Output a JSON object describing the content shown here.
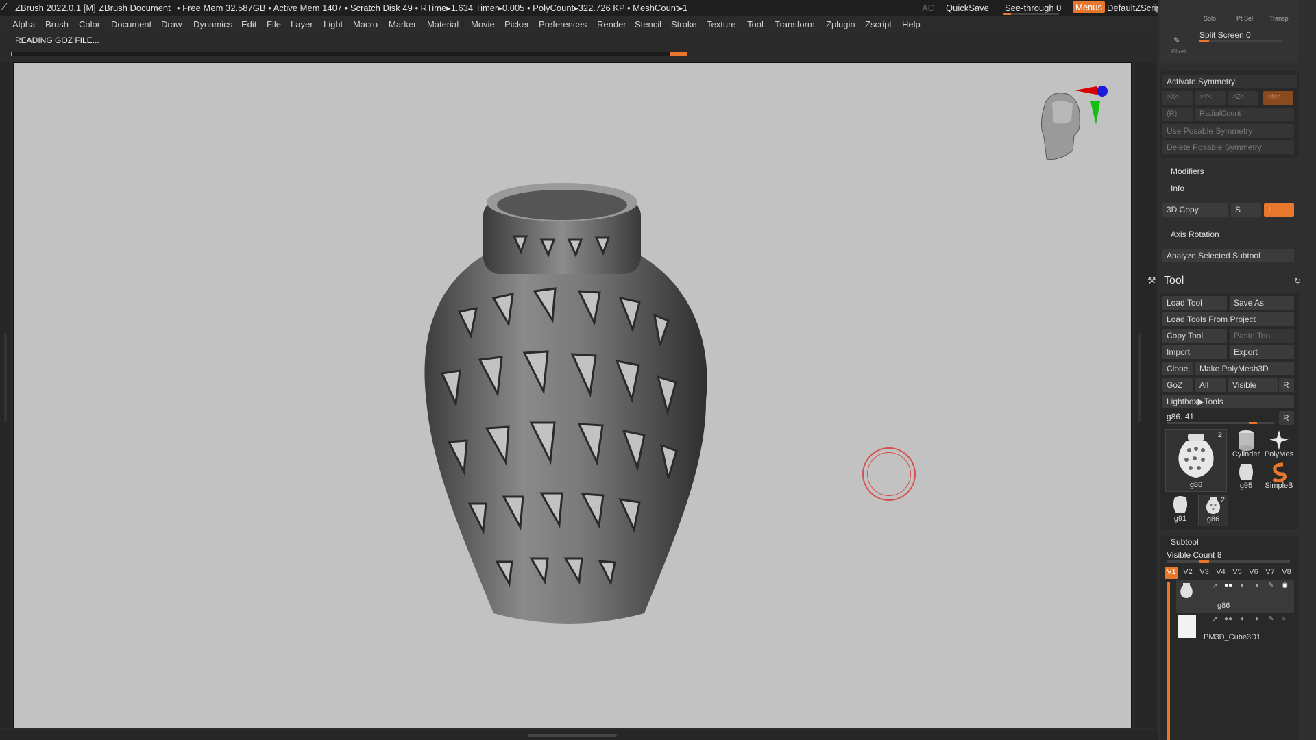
{
  "titlebar": {
    "app_title": "ZBrush 2022.0.1 [M]",
    "document": "ZBrush Document",
    "stats": "• Free Mem 32.587GB • Active Mem 1407 • Scratch Disk 49 •  RTime▸1.634 Timer▸0.005 • PolyCount▸322.726 KP  • MeshCount▸1",
    "ac": "AC",
    "quicksave": "QuickSave",
    "see_through": "See-through  0",
    "menus": "Menus",
    "script": "DefaultZScript"
  },
  "menubar": {
    "items": [
      "Alpha",
      "Brush",
      "Color",
      "Document",
      "Draw",
      "Dynamics",
      "Edit",
      "File",
      "Layer",
      "Light",
      "Macro",
      "Marker",
      "Material",
      "Movie",
      "Picker",
      "Preferences",
      "Render",
      "Stencil",
      "Stroke",
      "Texture",
      "Tool",
      "Transform",
      "Zplugin",
      "Zscript",
      "Help"
    ]
  },
  "notice": "READING GOZ FILE...",
  "palette": {
    "top_icons": {
      "solo": "Solo",
      "ptsel": "Pt Sel",
      "transp": "Transp",
      "ghost": "Ghost"
    },
    "split_screen": "Split Screen  0",
    "activate_symmetry": "Activate Symmetry",
    "sym_x": ">X<",
    "sym_y": ">Y<",
    "sym_z": ">Z<",
    "sym_m": ">M<",
    "sym_r": "(R)",
    "radial_count": "RadialCount",
    "use_posable": "Use Posable Symmetry",
    "delete_posable": "Delete Posable Symmetry",
    "modifiers": "Modifiers",
    "info": "Info",
    "copy3d": "3D Copy",
    "copy3d_s": "S",
    "copy3d_i": "I",
    "axis_rotation": "Axis Rotation",
    "analyze": "Analyze Selected Subtool",
    "tool_title": "Tool",
    "load_tool": "Load Tool",
    "save_as": "Save As",
    "load_from_project": "Load Tools From Project",
    "copy_tool": "Copy Tool",
    "paste_tool": "Paste Tool",
    "import": "Import",
    "export": "Export",
    "clone": "Clone",
    "make_polymesh": "Make PolyMesh3D",
    "goz": "GoZ",
    "all": "All",
    "visible": "Visible",
    "r": "R",
    "lightbox_tools": "Lightbox▶Tools",
    "tool_slider": "g86. 41",
    "tool_slider_r": "R",
    "thumbs": {
      "main_name": "g86",
      "main_count": "2",
      "cylinder": "Cylinder",
      "polymesh": "PolyMes",
      "g95": "g95",
      "simpleb": "SimpleB",
      "g91": "g91",
      "g86b": "g86",
      "g86b_count": "2"
    },
    "subtool_title": "Subtool",
    "visible_count": "Visible Count 8",
    "version_tabs": [
      "V1",
      "V2",
      "V3",
      "V4",
      "V5",
      "V6",
      "V7",
      "V8"
    ],
    "subtools": [
      "g86",
      "PM3D_Cube3D1"
    ]
  }
}
